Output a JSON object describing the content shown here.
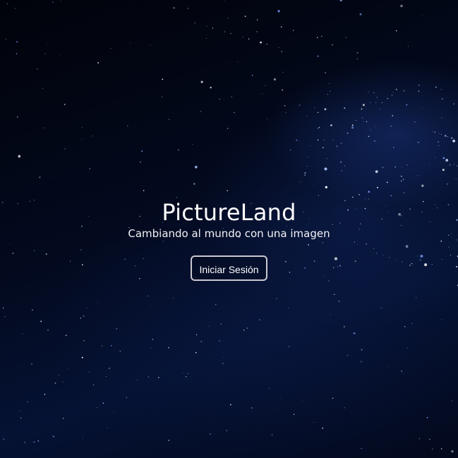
{
  "hero": {
    "title": "PictureLand",
    "subtitle": "Cambiando al mundo con una imagen",
    "login_label": "Iniciar Sesión"
  },
  "colors": {
    "background": "#02040d",
    "text": "#ffffff",
    "button_border": "#c9c9d2"
  }
}
